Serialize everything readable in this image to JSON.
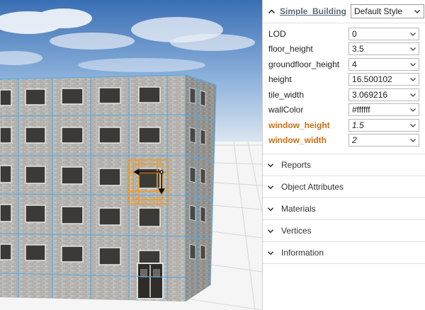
{
  "header": {
    "rule_name": "Simple_Building",
    "style_select": {
      "value": "Default Style"
    }
  },
  "attributes": [
    {
      "label": "LOD",
      "value": "0",
      "highlighted": false,
      "italic": false
    },
    {
      "label": "floor_height",
      "value": "3.5",
      "highlighted": false,
      "italic": false
    },
    {
      "label": "groundfloor_height",
      "value": "4",
      "highlighted": false,
      "italic": false
    },
    {
      "label": "height",
      "value": "16.500102",
      "highlighted": false,
      "italic": false
    },
    {
      "label": "tile_width",
      "value": "3.069216",
      "highlighted": false,
      "italic": false
    },
    {
      "label": "wallColor",
      "value": "#ffffff",
      "highlighted": false,
      "italic": false
    },
    {
      "label": "window_height",
      "value": "1.5",
      "highlighted": true,
      "italic": true
    },
    {
      "label": "window_width",
      "value": "2",
      "highlighted": true,
      "italic": true
    }
  ],
  "sections": [
    {
      "title": "Reports"
    },
    {
      "title": "Object Attributes"
    },
    {
      "title": "Materials"
    },
    {
      "title": "Vertices"
    },
    {
      "title": "Information"
    }
  ],
  "colors": {
    "highlight": "#c86e14",
    "link": "#5a6b7a",
    "selection": "#f39a1e",
    "wireframe": "#5aa8e0"
  },
  "icons": {
    "header_toggle": "chevron-up-icon",
    "section_toggle": "chevron-down-icon",
    "dropdown": "chevron-down-icon",
    "manipulator": "resize-arrows-icon"
  }
}
